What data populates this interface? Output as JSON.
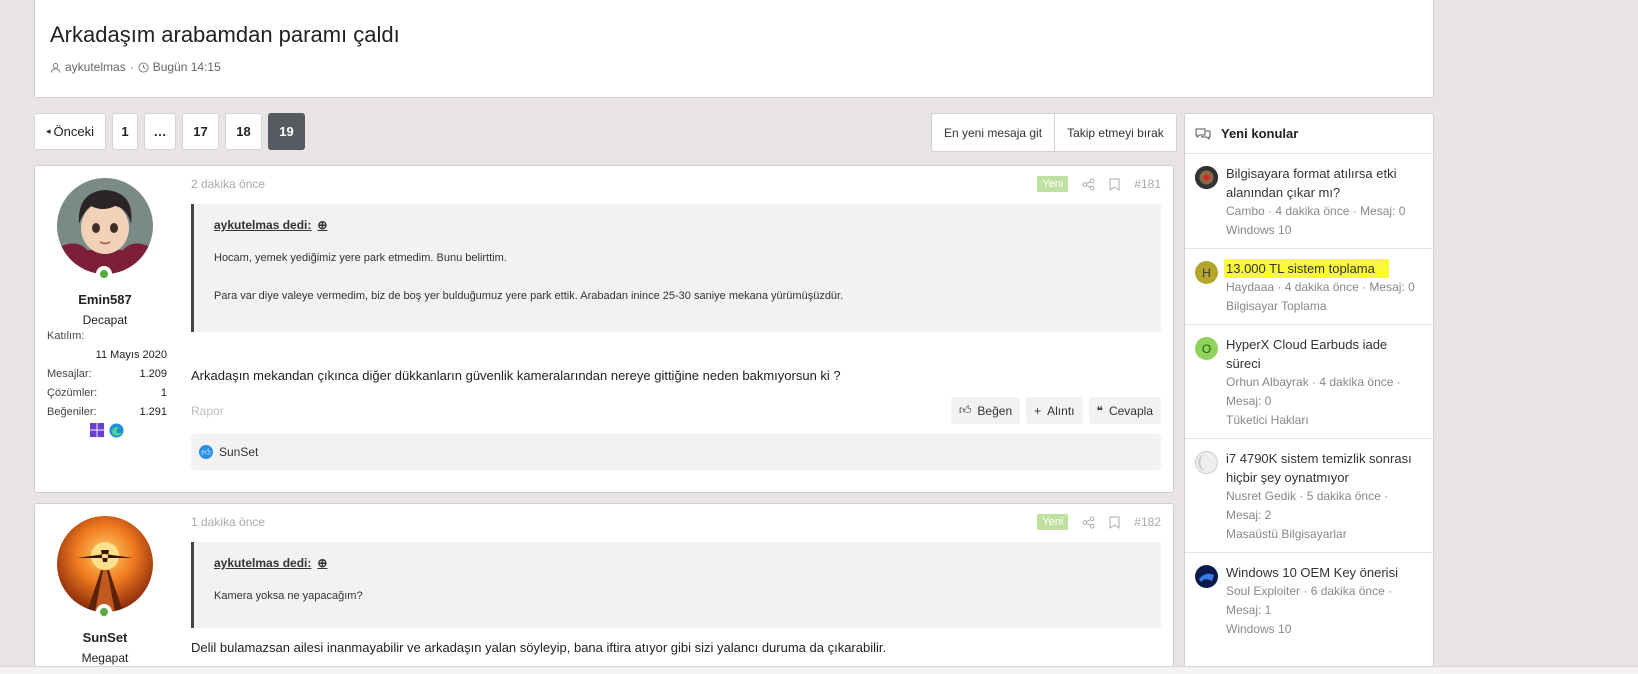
{
  "thread": {
    "title": "Arkadaşım arabamdan paramı çaldı",
    "author": "aykutelmas",
    "date": "Bugün 14:15"
  },
  "pagination": {
    "prev_label": "Önceki",
    "pages": [
      "1",
      "…",
      "17",
      "18",
      "19"
    ],
    "current": "19"
  },
  "thread_actions": {
    "latest_label": "En yeni mesaja git",
    "unwatch_label": "Takip etmeyi bırak"
  },
  "posts": [
    {
      "time": "2 dakika önce",
      "new_badge": "Yeni",
      "number": "#181",
      "user": {
        "name": "Emin587",
        "title": "Decapat",
        "join_label": "Katılım:",
        "join_date": "11 Mayıs 2020",
        "messages_label": "Mesajlar:",
        "messages": "1.209",
        "solutions_label": "Çözümler:",
        "solutions": "1",
        "likes_label": "Beğeniler:",
        "likes": "1.291"
      },
      "quote": {
        "author": "aykutelmas dedi:",
        "line1": "Hocam, yemek yediğimiz yere park etmedim. Bunu belirttim.",
        "line2": "Para var diye valeye vermedim, biz de boş yer bulduğumuz yere park ettik. Arabadan inince 25-30 saniye mekana yürümüşüzdür."
      },
      "body": "Arkadaşın mekandan çıkınca diğer dükkanların güvenlik kameralarından nereye gittiğine neden bakmıyorsun ki ?",
      "report_label": "Rapor",
      "like_label": "Beğen",
      "quote_label": "Alıntı",
      "reply_label": "Cevapla",
      "liked_by": "SunSet"
    },
    {
      "time": "1 dakika önce",
      "new_badge": "Yeni",
      "number": "#182",
      "user": {
        "name": "SunSet",
        "title": "Megapat"
      },
      "quote": {
        "author": "aykutelmas dedi:",
        "line1": "Kamera yoksa ne yapacağım?"
      },
      "body": "Delil bulamazsan ailesi inanmayabilir ve arkadaşın yalan söyleyip, bana iftira atıyor gibi sizi yalancı duruma da çıkarabilir."
    }
  ],
  "sidebar": {
    "title": "Yeni konular",
    "items": [
      {
        "title": "Bilgisayara format atılırsa etki alanından çıkar mı?",
        "meta": "Cambo · 4 dakika önce · Mesaj: 0",
        "category": "Windows 10",
        "avatar_letter": ""
      },
      {
        "title": "13.000 TL sistem toplama",
        "meta": "Haydaaa · 4 dakika önce · Mesaj: 0",
        "category": "Bilgisayar Toplama",
        "avatar_letter": "H"
      },
      {
        "title": "HyperX Cloud Earbuds iade süreci",
        "meta": "Orhun Albayrak · 4 dakika önce · Mesaj: 0",
        "category": "Tüketici Hakları",
        "avatar_letter": "O"
      },
      {
        "title": "i7 4790K sistem temizlik sonrası hiçbir şey oynatmıyor",
        "meta": "Nusret Gedik · 5 dakika önce · Mesaj: 2",
        "category": "Masaüstü Bilgisayarlar",
        "avatar_letter": ""
      },
      {
        "title": "Windows 10 OEM Key önerisi",
        "meta": "Soul Exploiter · 6 dakika önce · Mesaj: 1",
        "category": "Windows 10",
        "avatar_letter": ""
      }
    ]
  },
  "colors": {
    "highlight": "#fbfb33",
    "current_page": "#555b60",
    "online": "#5aab3f"
  }
}
